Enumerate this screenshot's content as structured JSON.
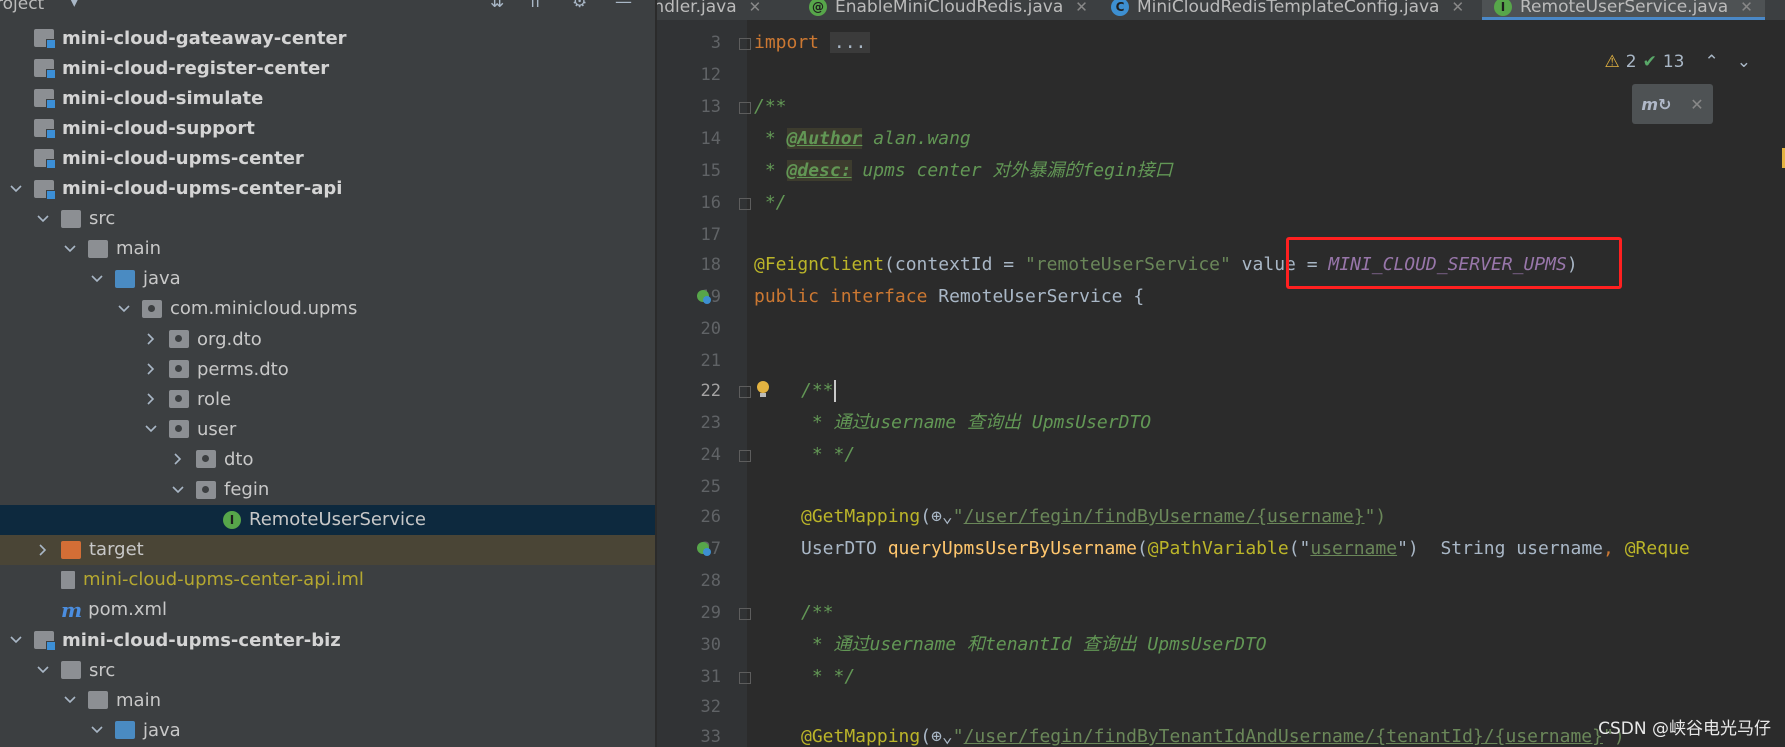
{
  "project_panel": {
    "title": "roject",
    "tree": [
      {
        "label": "mini-cloud-gateaway-center",
        "icon": "module-icon",
        "style": "bold",
        "depth": 0,
        "arrow": ""
      },
      {
        "label": "mini-cloud-register-center",
        "icon": "module-icon",
        "style": "bold",
        "depth": 0,
        "arrow": ""
      },
      {
        "label": "mini-cloud-simulate",
        "icon": "module-icon",
        "style": "bold",
        "depth": 0,
        "arrow": ""
      },
      {
        "label": "mini-cloud-support",
        "icon": "module-icon",
        "style": "bold",
        "depth": 0,
        "arrow": ""
      },
      {
        "label": "mini-cloud-upms-center",
        "icon": "module-icon",
        "style": "bold",
        "depth": 0,
        "arrow": ""
      },
      {
        "label": "mini-cloud-upms-center-api",
        "icon": "module-icon",
        "style": "bold",
        "depth": 0,
        "arrow": "down"
      },
      {
        "label": "src",
        "icon": "folder-grey",
        "style": "normal",
        "depth": 1,
        "arrow": "down"
      },
      {
        "label": "main",
        "icon": "folder-grey",
        "style": "normal",
        "depth": 2,
        "arrow": "down"
      },
      {
        "label": "java",
        "icon": "folder-blue",
        "style": "normal",
        "depth": 3,
        "arrow": "down"
      },
      {
        "label": "com.minicloud.upms",
        "icon": "package-icon",
        "style": "normal",
        "depth": 4,
        "arrow": "down"
      },
      {
        "label": "org.dto",
        "icon": "package-icon",
        "style": "normal",
        "depth": 5,
        "arrow": "right"
      },
      {
        "label": "perms.dto",
        "icon": "package-icon",
        "style": "normal",
        "depth": 5,
        "arrow": "right"
      },
      {
        "label": "role",
        "icon": "package-icon",
        "style": "normal",
        "depth": 5,
        "arrow": "right"
      },
      {
        "label": "user",
        "icon": "package-icon",
        "style": "normal",
        "depth": 5,
        "arrow": "down"
      },
      {
        "label": "dto",
        "icon": "package-icon",
        "style": "normal",
        "depth": 6,
        "arrow": "right"
      },
      {
        "label": "fegin",
        "icon": "package-icon",
        "style": "normal",
        "depth": 6,
        "arrow": "down"
      },
      {
        "label": "RemoteUserService",
        "icon": "interface-icon",
        "style": "normal",
        "depth": 7,
        "arrow": "",
        "selected": true
      },
      {
        "label": "target",
        "icon": "folder-orange",
        "style": "normal",
        "depth": 1,
        "arrow": "right",
        "highlight": true
      },
      {
        "label": "mini-cloud-upms-center-api.iml",
        "icon": "iml-file-icon",
        "style": "yellow",
        "depth": 1,
        "arrow": ""
      },
      {
        "label": "pom.xml",
        "icon": "maven-icon",
        "style": "normal",
        "depth": 1,
        "arrow": ""
      },
      {
        "label": "mini-cloud-upms-center-biz",
        "icon": "module-icon",
        "style": "bold",
        "depth": 0,
        "arrow": "down"
      },
      {
        "label": "src",
        "icon": "folder-grey",
        "style": "normal",
        "depth": 1,
        "arrow": "down"
      },
      {
        "label": "main",
        "icon": "folder-grey",
        "style": "normal",
        "depth": 2,
        "arrow": "down"
      },
      {
        "label": "java",
        "icon": "folder-blue",
        "style": "normal",
        "depth": 3,
        "arrow": "down"
      }
    ]
  },
  "tabs": [
    {
      "label": "andler.java",
      "badge": "",
      "active": false
    },
    {
      "label": "EnableMiniCloudRedis.java",
      "badge": "@",
      "badge_color": "#57a64a",
      "active": false
    },
    {
      "label": "MiniCloudRedisTemplateConfig.java",
      "badge": "C",
      "badge_color": "#3d8fd1",
      "active": false
    },
    {
      "label": "RemoteUserService.java",
      "badge": "I",
      "badge_color": "#57a64a",
      "active": true
    }
  ],
  "inspections": {
    "warnings": "2",
    "ok": "13"
  },
  "gutter_lines": [
    "3",
    "12",
    "13",
    "14",
    "15",
    "16",
    "17",
    "18",
    "19",
    "20",
    "21",
    "22",
    "23",
    "24",
    "25",
    "26",
    "27",
    "28",
    "29",
    "30",
    "31",
    "32",
    "33"
  ],
  "current_line": "22",
  "code": {
    "l3_kw": "import",
    "l3_fold": "...",
    "l13": "/**",
    "l14_star": " * ",
    "l14_tag": "@Author",
    "l14_text": " alan.wang",
    "l15_star": " * ",
    "l15_tag": "@desc:",
    "l15_text": " upms center 对外暴漏的fegin接口",
    "l16": " */",
    "l18_ann": "@FeignClient",
    "l18_a": "(contextId = ",
    "l18_str": "\"remoteUserService\"",
    "l18_b": " value = ",
    "l18_const": "MINI_CLOUD_SERVER_UPMS",
    "l18_c": ")",
    "l19_kw1": "public",
    "l19_kw2": "interface",
    "l19_name": " RemoteUserService {",
    "l22": "/**",
    "l23": " * 通过username 查询出 UpmsUserDTO",
    "l24": " * */",
    "l26_ann": "@GetMapping",
    "l26_open": "(",
    "l26_q": "\"",
    "l26_path": "/user/fegin/findByUsername/{username}",
    "l26_end": "\")",
    "l27_type": "UserDTO ",
    "l27_method": "queryUpmsUserByUsername",
    "l27_p": "(",
    "l27_ann": "@PathVariable",
    "l27_q1": "(\"",
    "l27_str": "username",
    "l27_q2": "\")",
    "l27_rest": "  String username",
    "l27_comma": ", ",
    "l27_ann2": "@Reque",
    "l29": "/**",
    "l30": " * 通过username 和tenantId 查询出 UpmsUserDTO",
    "l31": " * */",
    "l33_ann": "@GetMapping",
    "l33_open": "(",
    "l33_q": "\"",
    "l33_path": "/user/fegin/findByTenantIdAndUsername/{tenantId}/{username}",
    "l33_end": "\")"
  },
  "watermark": "CSDN @峡谷电光马仔"
}
